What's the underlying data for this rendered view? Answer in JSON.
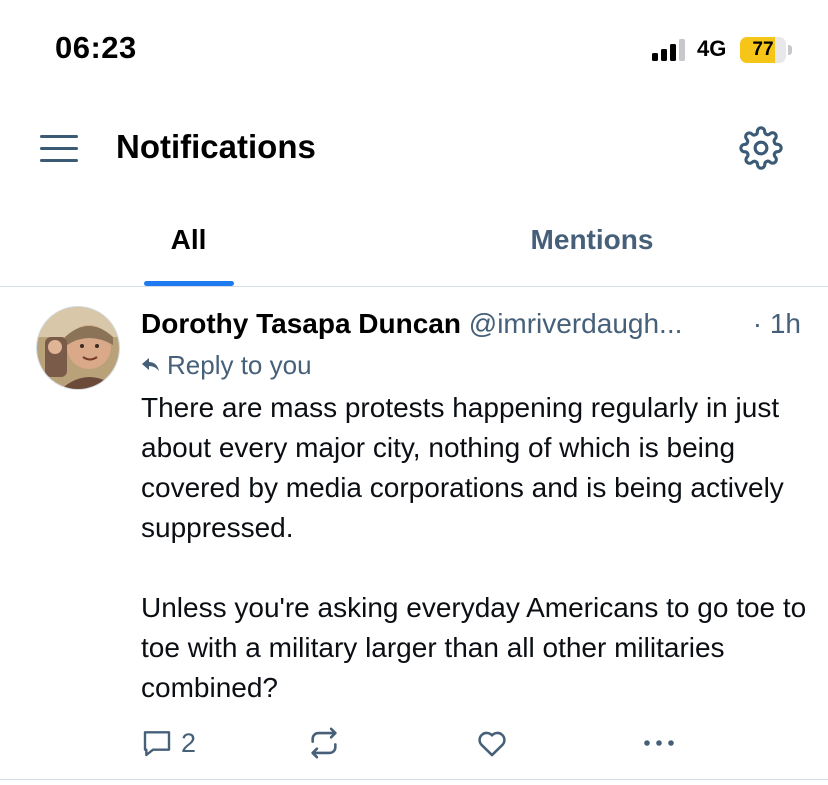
{
  "status_bar": {
    "time": "06:23",
    "network": "4G",
    "battery_level": "77",
    "battery_fraction": 0.77,
    "battery_color": "#f5c518"
  },
  "header": {
    "title": "Notifications",
    "menu_icon": "hamburger-menu-icon",
    "settings_icon": "gear-icon"
  },
  "tabs": [
    {
      "label": "All",
      "active": true
    },
    {
      "label": "Mentions",
      "active": false
    }
  ],
  "accent_color": "#1e7bef",
  "notification": {
    "author_name": "Dorothy Tasapa Duncan",
    "author_handle": "@imriverdaugh...",
    "time": "· 1h",
    "reply_label": "Reply to you",
    "text": "There are mass protests happening regularly in just about every major city, nothing of which is being covered by media corporations and is being actively suppressed.\n\nUnless you're asking everyday Americans to go toe to toe with a military larger than all other militaries combined?",
    "reply_count": "2",
    "action_icons": [
      "comment-icon",
      "repost-icon",
      "heart-icon",
      "more-icon"
    ]
  }
}
